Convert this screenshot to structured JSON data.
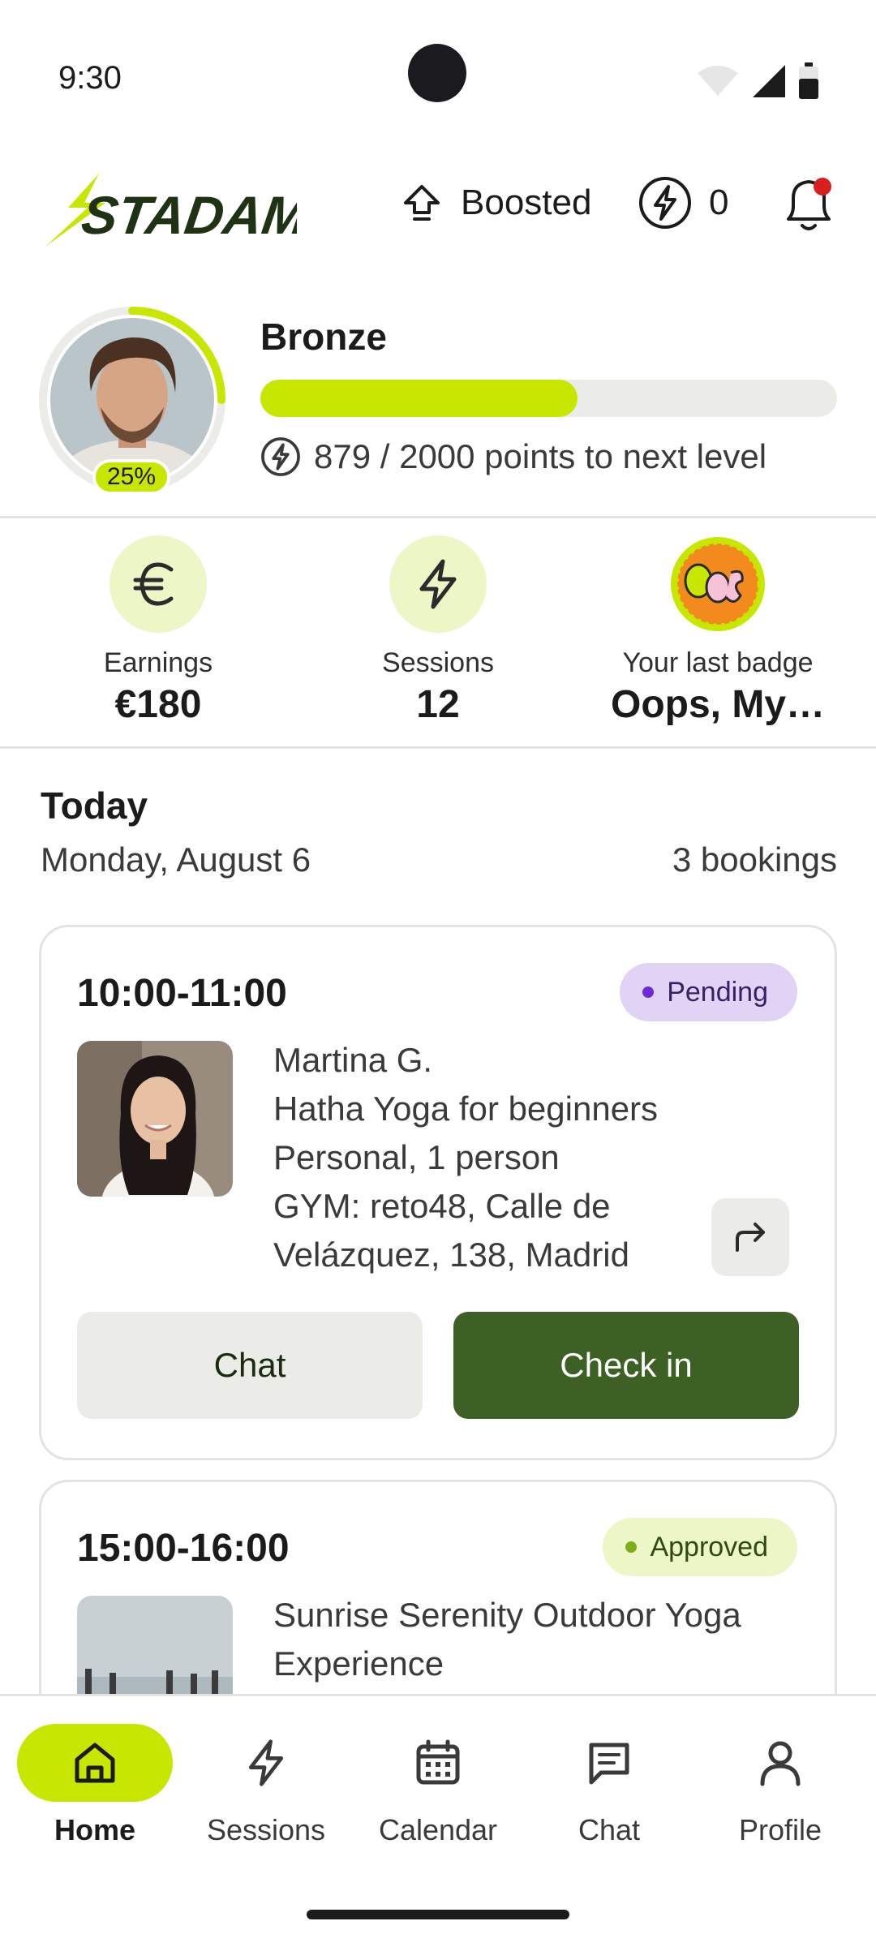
{
  "status_bar": {
    "time": "9:30"
  },
  "header": {
    "logo_text": "STADAMI",
    "boosted_label": "Boosted",
    "points_count": "0"
  },
  "level": {
    "name": "Bronze",
    "percent_label": "25%",
    "progress_fraction": 0.55,
    "points_text": "879 / 2000 points to next level"
  },
  "stats": [
    {
      "label": "Earnings",
      "value": "€180",
      "icon": "euro-icon"
    },
    {
      "label": "Sessions",
      "value": "12",
      "icon": "bolt-icon"
    },
    {
      "label": "Your last badge",
      "value": "Oops, My…",
      "icon": "oops-badge"
    }
  ],
  "today": {
    "title": "Today",
    "date": "Monday, August 6",
    "count": "3 bookings"
  },
  "bookings": [
    {
      "time": "10:00-11:00",
      "status": "Pending",
      "lines": [
        "Martina G.",
        "Hatha Yoga for beginners",
        "Personal, 1 person",
        "GYM: reto48, Calle de",
        "Velázquez, 138, Madrid"
      ],
      "chat_label": "Chat",
      "checkin_label": "Check in"
    },
    {
      "time": "15:00-16:00",
      "status": "Approved",
      "lines": [
        "Sunrise Serenity Outdoor Yoga",
        "Experience"
      ]
    }
  ],
  "nav": [
    {
      "label": "Home",
      "icon": "home-icon",
      "active": true
    },
    {
      "label": "Sessions",
      "icon": "bolt-icon",
      "active": false
    },
    {
      "label": "Calendar",
      "icon": "calendar-icon",
      "active": false
    },
    {
      "label": "Chat",
      "icon": "chat-icon",
      "active": false
    },
    {
      "label": "Profile",
      "icon": "profile-icon",
      "active": false
    }
  ],
  "colors": {
    "accent": "#c7e600",
    "primary_button": "#3d6125",
    "pending_bg": "#e1d3f6",
    "approved_bg": "#ecf6c6",
    "notification_dot": "#d62020"
  }
}
